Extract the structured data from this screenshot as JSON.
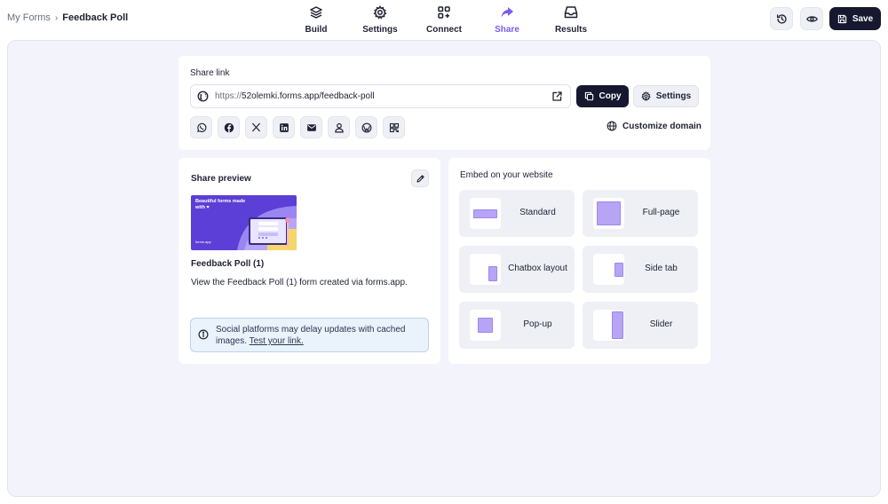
{
  "breadcrumb": {
    "parent": "My Forms",
    "separator": "›",
    "current": "Feedback Poll"
  },
  "nav": [
    {
      "label": "Build",
      "icon": "layers-icon"
    },
    {
      "label": "Settings",
      "icon": "gear-icon"
    },
    {
      "label": "Connect",
      "icon": "connect-grid-icon"
    },
    {
      "label": "Share",
      "icon": "share-arrow-icon",
      "active": true
    },
    {
      "label": "Results",
      "icon": "inbox-tray-icon"
    }
  ],
  "toolbar": {
    "save_label": "Save"
  },
  "share_link": {
    "title": "Share link",
    "url_protocol": "https://",
    "url_rest": "52olemki.forms.app/feedback-poll",
    "copy_label": "Copy",
    "settings_label": "Settings",
    "customize_domain_label": "Customize domain",
    "social": [
      "whatsapp-icon",
      "facebook-icon",
      "x-icon",
      "linkedin-icon",
      "email-icon",
      "person-icon",
      "wordpress-icon",
      "qr-code-icon"
    ]
  },
  "preview": {
    "title": "Share preview",
    "image_text": "Beautiful forms made with ♥",
    "image_brand": "forms.app",
    "form_title": "Feedback Poll (1)",
    "description": "View the Feedback Poll (1) form created via forms.app.",
    "notice_text": "Social platforms may delay updates with cached images.",
    "notice_link": "Test your link."
  },
  "embed": {
    "title": "Embed on your website",
    "options": [
      {
        "label": "Standard"
      },
      {
        "label": "Full-page"
      },
      {
        "label": "Chatbox layout"
      },
      {
        "label": "Side tab"
      },
      {
        "label": "Pop-up"
      },
      {
        "label": "Slider"
      }
    ]
  },
  "colors": {
    "accent": "#7b5cf2",
    "dark": "#161830",
    "workspace": "#f3f3fb",
    "embed_shape": "#b7a4f5"
  }
}
